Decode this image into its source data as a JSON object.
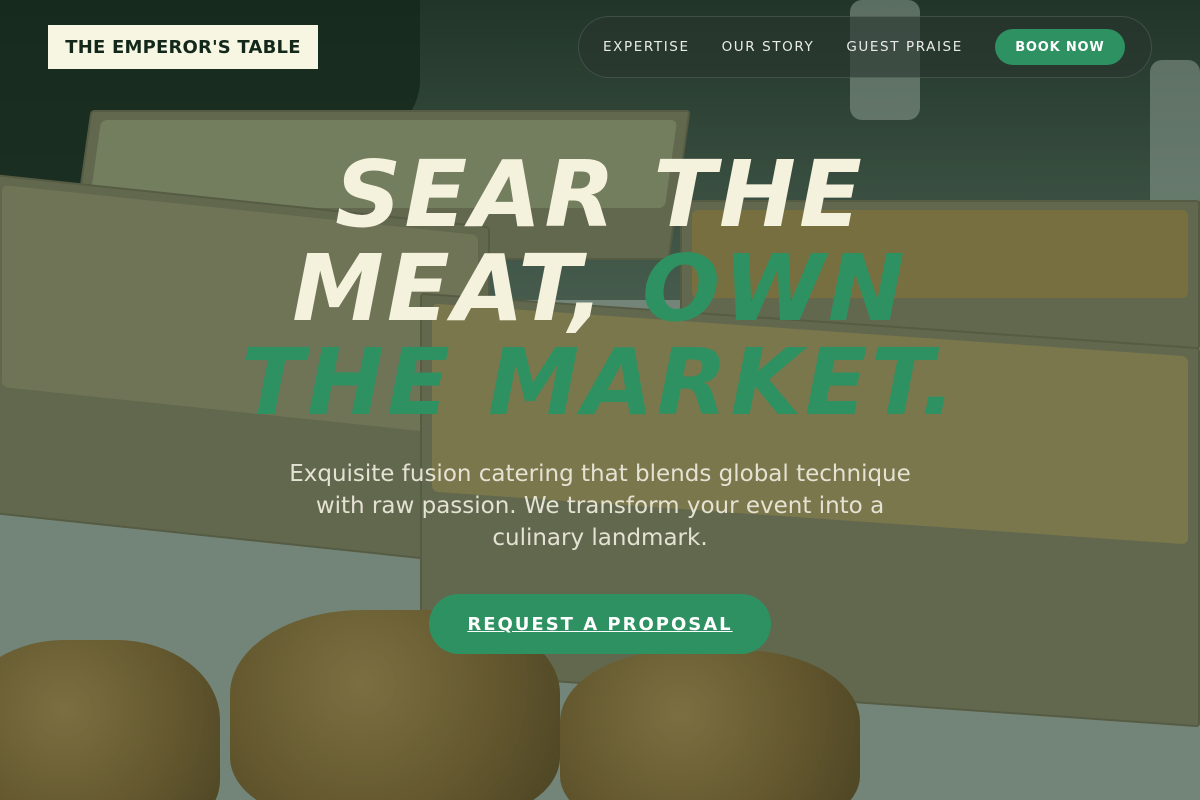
{
  "brand": {
    "name": "THE EMPEROR'S TABLE"
  },
  "nav": {
    "items": [
      "EXPERTISE",
      "OUR STORY",
      "GUEST PRAISE"
    ],
    "book_label": "BOOK NOW"
  },
  "hero": {
    "title_line1": "SEAR THE",
    "title_line2_a": "MEAT,",
    "title_line2_b": "OWN",
    "title_line3": "THE MARKET.",
    "subtitle": "Exquisite fusion catering that blends global technique with raw passion. We transform your event into a culinary landmark.",
    "cta_label": "REQUEST A PROPOSAL"
  },
  "colors": {
    "accent": "#2e9161",
    "cream": "#f4f1dc",
    "overlay": "#1c3c28"
  }
}
